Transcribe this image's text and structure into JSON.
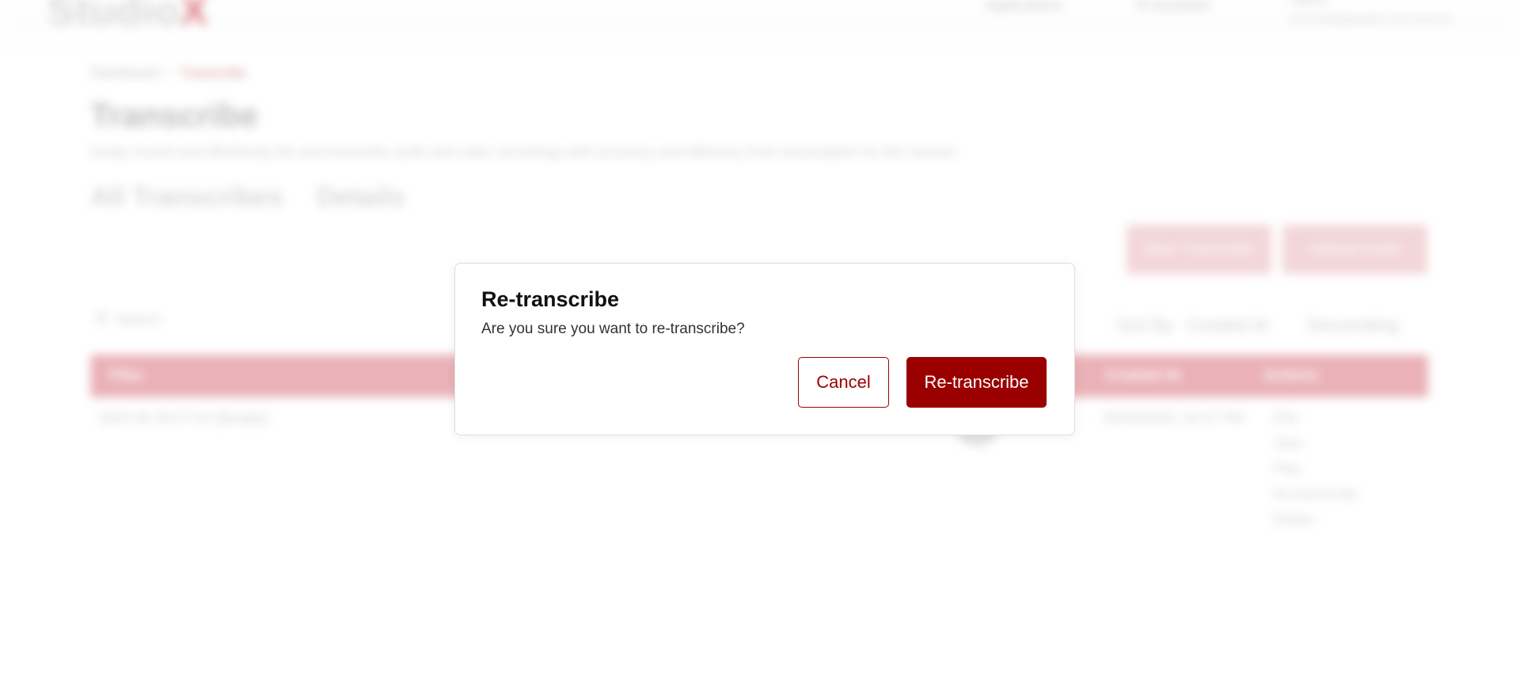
{
  "app": {
    "logo_text": "Studio",
    "logo_accent": "X",
    "nav": [
      "Applications",
      "AI Assistant"
    ],
    "user_name": "Admin",
    "user_email": "transcribe@studiox.com Account"
  },
  "breadcrumb": {
    "home": "Dashboard",
    "separator": "/",
    "current": "Transcribe"
  },
  "page": {
    "title": "Transcribe",
    "description": "Easily record and effortlessly file and transcribe audio and video recordings with accuracy and efficiency from transcription for the masses",
    "tabs": [
      "All Transcribes",
      "Details"
    ]
  },
  "toolbar": {
    "new_label": "New Transcribe",
    "upload_label": "Upload Audio",
    "search_placeholder": "Search",
    "sort_label": "Sort By",
    "sort_field": "Created At",
    "sort_order": "Descending"
  },
  "table": {
    "columns": [
      "Files",
      "Created At",
      "Actions"
    ],
    "rows": [
      {
        "file": "2025-06-28 07:54 (Bangla)",
        "created_at": "06/28/2025, 02:07 PM",
        "actions": [
          "Edit",
          "View",
          "Play",
          "Re-transcribe",
          "Delete"
        ]
      }
    ]
  },
  "modal": {
    "title": "Re-transcribe",
    "message": "Are you sure you want to re-transcribe?",
    "cancel_label": "Cancel",
    "confirm_label": "Re-transcribe"
  },
  "colors": {
    "primary": "#9b0000",
    "primary_light": "#e9b4ba",
    "table_header": "#d9737d"
  },
  "icons": {
    "search": "search-icon",
    "sort_chevron": "chevron-down-icon"
  }
}
